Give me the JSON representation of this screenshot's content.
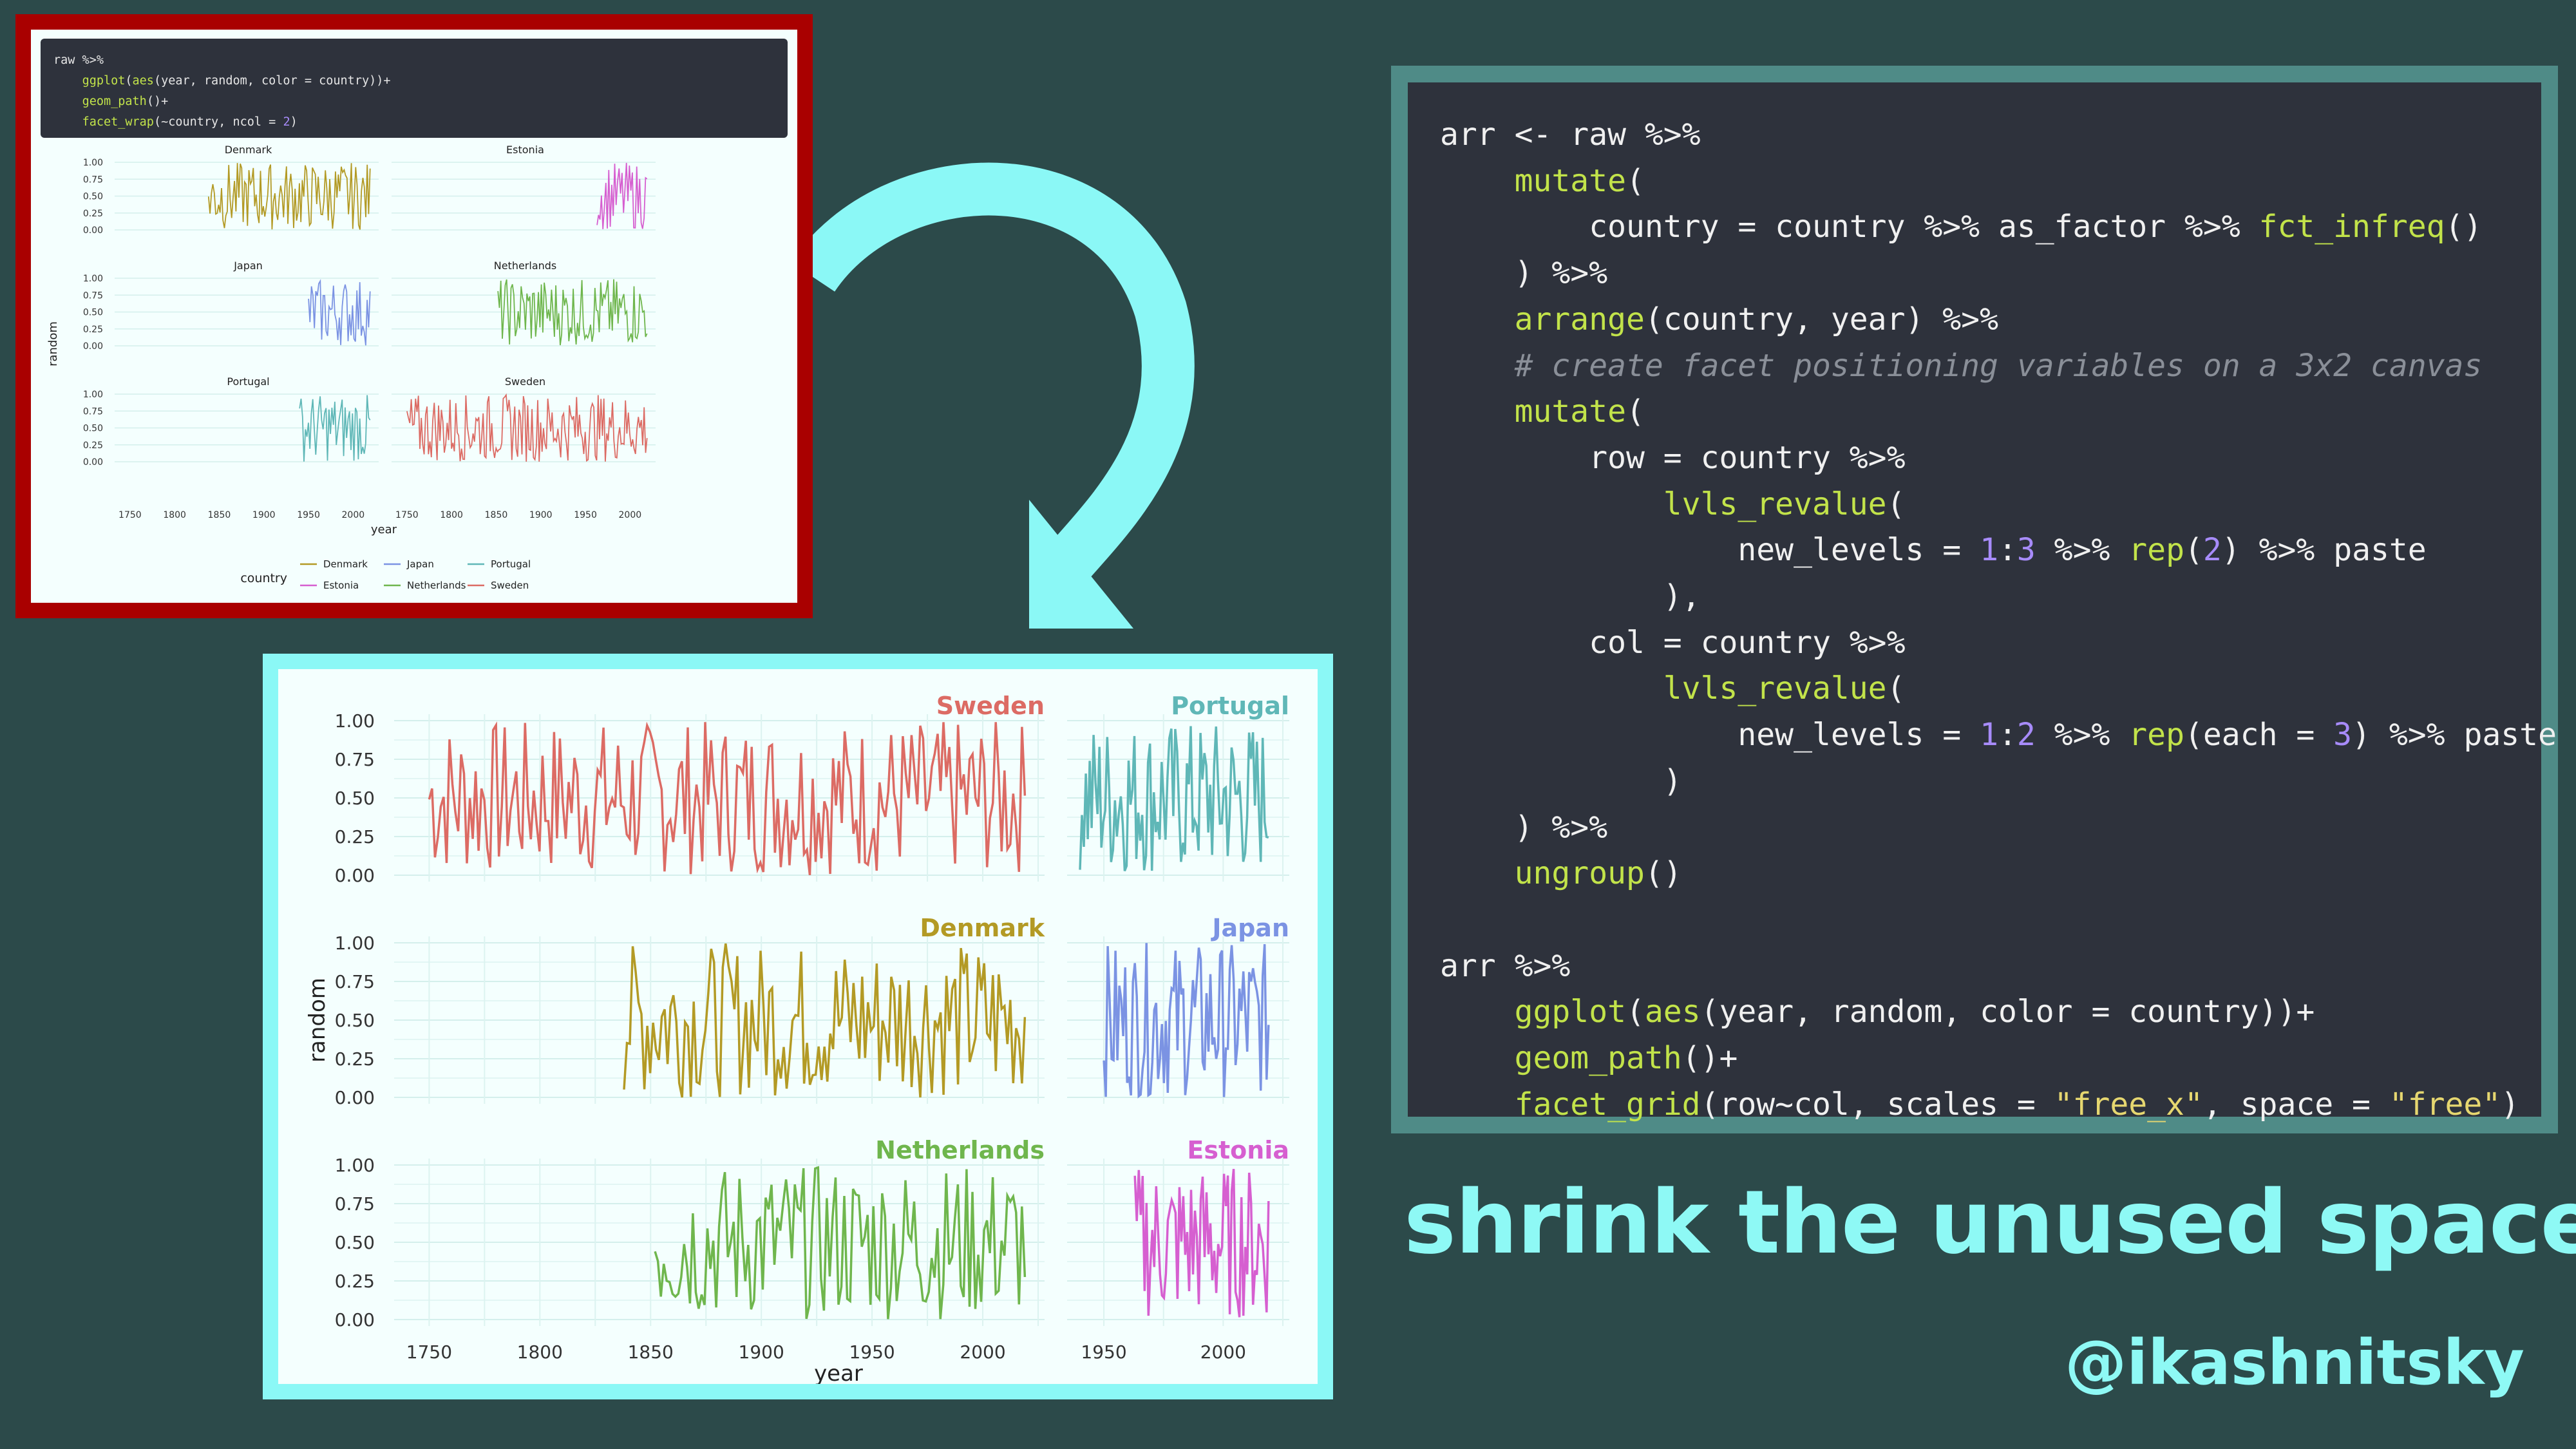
{
  "before_panel": {
    "code_lines": [
      {
        "parts": [
          {
            "t": "raw %>%",
            "c": ""
          }
        ]
      },
      {
        "parts": [
          {
            "t": "    ",
            "c": ""
          },
          {
            "t": "ggplot",
            "c": "lime"
          },
          {
            "t": "(",
            "c": ""
          },
          {
            "t": "aes",
            "c": "lime"
          },
          {
            "t": "(year, random, color = country))+",
            "c": ""
          }
        ]
      },
      {
        "parts": [
          {
            "t": "    ",
            "c": ""
          },
          {
            "t": "geom_path",
            "c": "lime"
          },
          {
            "t": "()+",
            "c": ""
          }
        ]
      },
      {
        "parts": [
          {
            "t": "    ",
            "c": ""
          },
          {
            "t": "facet_wrap",
            "c": "lime"
          },
          {
            "t": "(~country, ncol = ",
            "c": ""
          },
          {
            "t": "2",
            "c": "purple"
          },
          {
            "t": ")",
            "c": ""
          }
        ]
      }
    ],
    "facets": [
      "Denmark",
      "Estonia",
      "Japan",
      "Netherlands",
      "Portugal",
      "Sweden"
    ],
    "y_ticks": [
      "1.00",
      "0.75",
      "0.50",
      "0.25",
      "0.00"
    ],
    "x_ticks": [
      "1750",
      "1800",
      "1850",
      "1900",
      "1950",
      "2000"
    ],
    "xlabel": "year",
    "ylabel": "random",
    "legend_title": "country",
    "legend_items": [
      "Denmark",
      "Estonia",
      "Japan",
      "Netherlands",
      "Portugal",
      "Sweden"
    ]
  },
  "after_panel": {
    "row1": [
      "Sweden",
      "Portugal"
    ],
    "row2": [
      "Denmark",
      "Japan"
    ],
    "row3": [
      "Netherlands",
      "Estonia"
    ],
    "y_ticks": [
      "1.00",
      "0.75",
      "0.50",
      "0.25",
      "0.00"
    ],
    "x_ticks_left": [
      "1750",
      "1800",
      "1850",
      "1900",
      "1950",
      "2000"
    ],
    "x_ticks_right": [
      "1950",
      "2000"
    ],
    "xlabel": "year",
    "ylabel": "random"
  },
  "code_lines": [
    {
      "parts": [
        {
          "t": "arr <- raw %>%",
          "c": ""
        }
      ]
    },
    {
      "parts": [
        {
          "t": "    ",
          "c": ""
        },
        {
          "t": "mutate",
          "c": "lime"
        },
        {
          "t": "(",
          "c": ""
        }
      ]
    },
    {
      "parts": [
        {
          "t": "        country = country %>% as_factor %>% ",
          "c": ""
        },
        {
          "t": "fct_infreq",
          "c": "lime"
        },
        {
          "t": "()",
          "c": ""
        }
      ]
    },
    {
      "parts": [
        {
          "t": "    ) %>%",
          "c": ""
        }
      ]
    },
    {
      "parts": [
        {
          "t": "    ",
          "c": ""
        },
        {
          "t": "arrange",
          "c": "lime"
        },
        {
          "t": "(country, year) %>%",
          "c": ""
        }
      ]
    },
    {
      "parts": [
        {
          "t": "    ",
          "c": ""
        },
        {
          "t": "# create facet positioning variables on a 3x2 canvas",
          "c": "grey"
        }
      ]
    },
    {
      "parts": [
        {
          "t": "    ",
          "c": ""
        },
        {
          "t": "mutate",
          "c": "lime"
        },
        {
          "t": "(",
          "c": ""
        }
      ]
    },
    {
      "parts": [
        {
          "t": "        row = country %>%",
          "c": ""
        }
      ]
    },
    {
      "parts": [
        {
          "t": "            ",
          "c": ""
        },
        {
          "t": "lvls_revalue",
          "c": "lime"
        },
        {
          "t": "(",
          "c": ""
        }
      ]
    },
    {
      "parts": [
        {
          "t": "                new_levels = ",
          "c": ""
        },
        {
          "t": "1",
          "c": "purple"
        },
        {
          "t": ":",
          "c": ""
        },
        {
          "t": "3",
          "c": "purple"
        },
        {
          "t": " %>% ",
          "c": ""
        },
        {
          "t": "rep",
          "c": "lime"
        },
        {
          "t": "(",
          "c": ""
        },
        {
          "t": "2",
          "c": "purple"
        },
        {
          "t": ") %>% paste",
          "c": ""
        }
      ]
    },
    {
      "parts": [
        {
          "t": "            ),",
          "c": ""
        }
      ]
    },
    {
      "parts": [
        {
          "t": "        col = country %>%",
          "c": ""
        }
      ]
    },
    {
      "parts": [
        {
          "t": "            ",
          "c": ""
        },
        {
          "t": "lvls_revalue",
          "c": "lime"
        },
        {
          "t": "(",
          "c": ""
        }
      ]
    },
    {
      "parts": [
        {
          "t": "                new_levels = ",
          "c": ""
        },
        {
          "t": "1",
          "c": "purple"
        },
        {
          "t": ":",
          "c": ""
        },
        {
          "t": "2",
          "c": "purple"
        },
        {
          "t": " %>% ",
          "c": ""
        },
        {
          "t": "rep",
          "c": "lime"
        },
        {
          "t": "(each = ",
          "c": ""
        },
        {
          "t": "3",
          "c": "purple"
        },
        {
          "t": ") %>% paste",
          "c": ""
        }
      ]
    },
    {
      "parts": [
        {
          "t": "            )",
          "c": ""
        }
      ]
    },
    {
      "parts": [
        {
          "t": "    ) %>%",
          "c": ""
        }
      ]
    },
    {
      "parts": [
        {
          "t": "    ",
          "c": ""
        },
        {
          "t": "ungroup",
          "c": "lime"
        },
        {
          "t": "()",
          "c": ""
        }
      ]
    },
    {
      "parts": [
        {
          "t": "",
          "c": ""
        }
      ]
    },
    {
      "parts": [
        {
          "t": "arr %>%",
          "c": ""
        }
      ]
    },
    {
      "parts": [
        {
          "t": "    ",
          "c": ""
        },
        {
          "t": "ggplot",
          "c": "lime"
        },
        {
          "t": "(",
          "c": ""
        },
        {
          "t": "aes",
          "c": "lime"
        },
        {
          "t": "(year, random, color = country))+",
          "c": ""
        }
      ]
    },
    {
      "parts": [
        {
          "t": "    ",
          "c": ""
        },
        {
          "t": "geom_path",
          "c": "lime"
        },
        {
          "t": "()+",
          "c": ""
        }
      ]
    },
    {
      "parts": [
        {
          "t": "    ",
          "c": ""
        },
        {
          "t": "facet_grid",
          "c": "lime"
        },
        {
          "t": "(row~col, scales = ",
          "c": ""
        },
        {
          "t": "\"free_x\"",
          "c": "yellow"
        },
        {
          "t": ", space = ",
          "c": ""
        },
        {
          "t": "\"free\"",
          "c": "yellow"
        },
        {
          "t": ")",
          "c": ""
        }
      ]
    }
  ],
  "tagline": "shrink the unused space",
  "handle": "@ikashnitsky",
  "colors": {
    "background": "#2c4a4a",
    "accent": "#8ef9f5",
    "before_border": "#a90000",
    "Sweden": "#dc6b64",
    "Portugal": "#5fb7b7",
    "Denmark": "#b39a25",
    "Japan": "#7b93e3",
    "Netherlands": "#6fb64d",
    "Estonia": "#d65fd0"
  }
}
